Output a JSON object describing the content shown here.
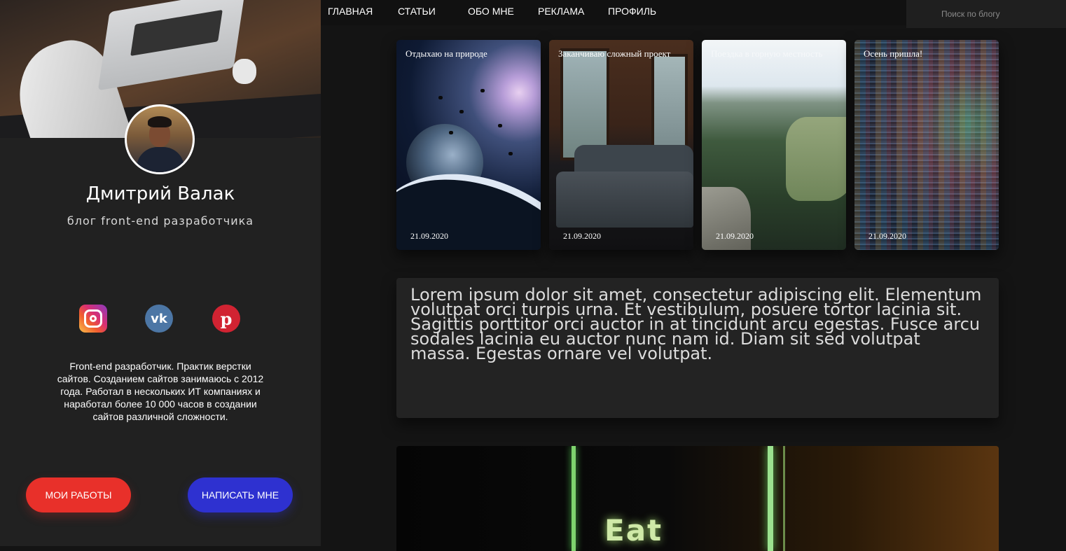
{
  "nav": {
    "items": [
      "ГЛАВНАЯ",
      "СТАТЬИ",
      "ОБО МНЕ",
      "РЕКЛАМА",
      "ПРОФИЛЬ"
    ],
    "search_placeholder": "Поиск по блогу"
  },
  "profile": {
    "name": "Дмитрий Валак",
    "subtitle": "блог front-end разработчика",
    "bio": "Front-end разработчик. Практик верстки сайтов. Созданием сайтов занимаюсь с 2012 года. Работал в нескольких ИТ компаниях и наработал более 10 000 часов в создании сайтов различной сложности.",
    "socials": [
      {
        "icon": "instagram-icon"
      },
      {
        "icon": "vk-icon",
        "glyph": "vk"
      },
      {
        "icon": "pinterest-icon",
        "glyph": "p"
      }
    ],
    "buttons": {
      "works": "МОИ РАБОТЫ",
      "write": "НАПИСАТЬ МНЕ"
    }
  },
  "cards": [
    {
      "title": "Отдыхаю на природе",
      "date": "21.09.2020"
    },
    {
      "title": "Заканчиваю сложный проект",
      "date": "21.09.2020"
    },
    {
      "title": "Поездка в горную местность",
      "date": "21.09.2020"
    },
    {
      "title": "Осень пришла!",
      "date": "21.09.2020"
    }
  ],
  "lorem": "Lorem ipsum dolor sit amet, consectetur adipiscing elit. Elementum volutpat orci turpis urna. Et vestibulum, posuere tortor lacinia sit. Sagittis porttitor orci auctor in at tincidunt arcu egestas. Fusce arcu sodales lacinia eu auctor nunc nam id. Diam sit sed volutpat massa. Egestas ornare vel volutpat.",
  "hero": {
    "neon_text": "Eat"
  },
  "colors": {
    "primary_button": "#e8302a",
    "secondary_button": "#2e31d0",
    "sidebar_bg": "#212121",
    "page_bg": "#141414"
  }
}
